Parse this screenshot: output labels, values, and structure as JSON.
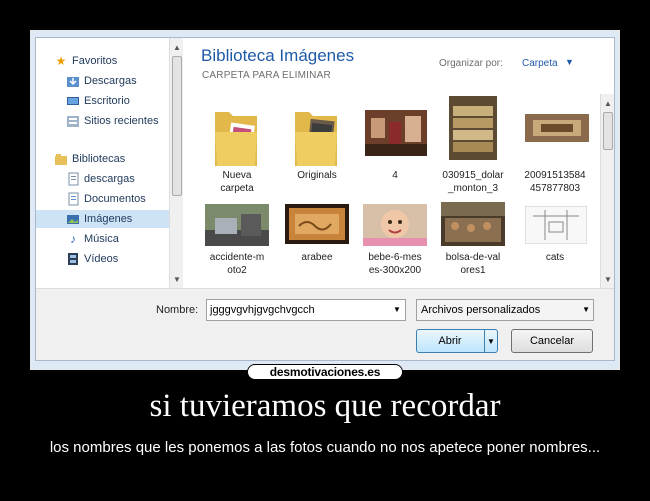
{
  "dialog": {
    "sidebar": {
      "favorites_header": "Favoritos",
      "items_favorites": [
        "Descargas",
        "Escritorio",
        "Sitios recientes"
      ],
      "libraries_header": "Bibliotecas",
      "items_libraries": [
        "descargas",
        "Documentos",
        "Imágenes",
        "Música",
        "Vídeos"
      ],
      "selected": "Imágenes"
    },
    "main": {
      "title": "Biblioteca Imágenes",
      "subtitle": "CARPETA PARA ELIMINAR",
      "arrange_label": "Organizar por:",
      "arrange_value": "Carpeta",
      "items": [
        {
          "label_line1": "Nueva",
          "label_line2": "carpeta",
          "kind": "folder-icon"
        },
        {
          "label_line1": "Originals",
          "label_line2": "",
          "kind": "folder-icon"
        },
        {
          "label_line1": "4",
          "label_line2": "",
          "kind": "photo"
        },
        {
          "label_line1": "030915_dolar",
          "label_line2": "_monton_3",
          "kind": "photo"
        },
        {
          "label_line1": "20091513584",
          "label_line2": "457877803",
          "kind": "photo"
        },
        {
          "label_line1": "accidente-m",
          "label_line2": "oto2",
          "kind": "photo"
        },
        {
          "label_line1": "arabee",
          "label_line2": "",
          "kind": "photo"
        },
        {
          "label_line1": "bebe-6-mes",
          "label_line2": "es-300x200",
          "kind": "photo"
        },
        {
          "label_line1": "bolsa-de-val",
          "label_line2": "ores1",
          "kind": "photo"
        },
        {
          "label_line1": "cats",
          "label_line2": "",
          "kind": "photo"
        }
      ]
    },
    "bottom": {
      "name_label": "Nombre:",
      "name_value": "jgggvgvhjgvgchvgcch",
      "filter_value": "Archivos personalizados",
      "open_label": "Abrir",
      "cancel_label": "Cancelar"
    }
  },
  "poster": {
    "site": "desmotivaciones.es",
    "headline": "si tuvieramos que recordar",
    "subtext": "los nombres que les ponemos a las fotos cuando no nos apetece poner nombres..."
  },
  "colors": {
    "accent": "#1e5aa8",
    "selected": "#cfe3f7"
  }
}
